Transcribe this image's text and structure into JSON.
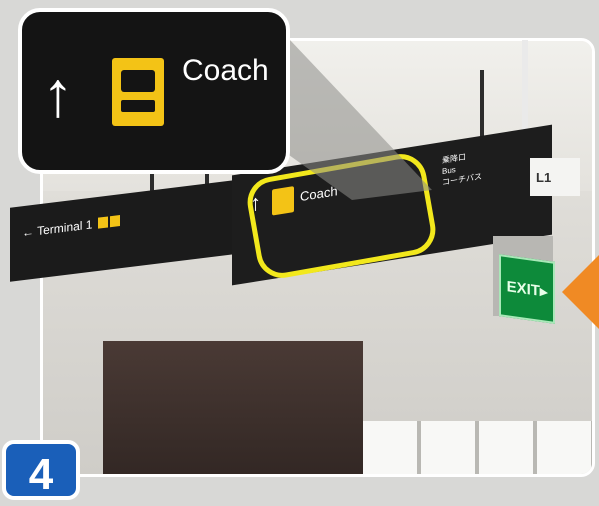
{
  "photo": {
    "zoom_label": "Coach",
    "sign_coach_label": "Coach",
    "sign_terminal_label": "Terminal 1",
    "sign_japanese_lines": [
      "乗降口",
      "Bus",
      "コーチバス"
    ],
    "level_label": "L1",
    "exit_label": "EXIT",
    "highlight_color": "#f2e81c",
    "marker_color": "#f08a24"
  },
  "step_badge": {
    "number": "4",
    "color": "#1a5fb9"
  }
}
